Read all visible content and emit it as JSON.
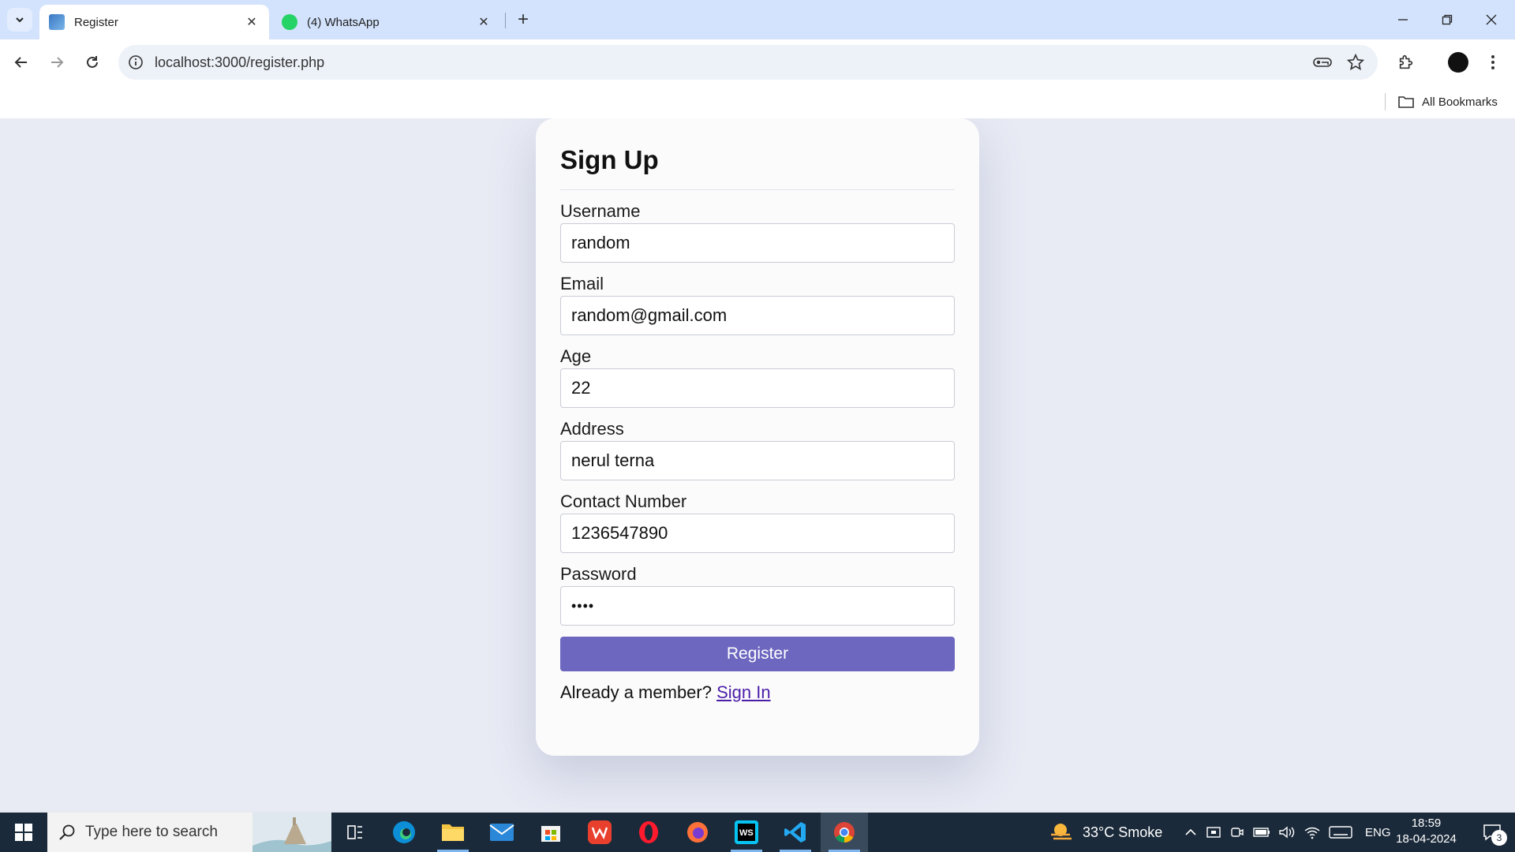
{
  "browser": {
    "tabs": [
      {
        "title": "Register",
        "active": true
      },
      {
        "title": "(4) WhatsApp",
        "active": false
      }
    ],
    "url": "localhost:3000/register.php",
    "bookmarks_label": "All Bookmarks"
  },
  "form": {
    "title": "Sign Up",
    "fields": [
      {
        "label": "Username",
        "value": "random"
      },
      {
        "label": "Email",
        "value": "random@gmail.com"
      },
      {
        "label": "Age",
        "value": "22"
      },
      {
        "label": "Address",
        "value": "nerul terna"
      },
      {
        "label": "Contact Number",
        "value": "1236547890"
      },
      {
        "label": "Password",
        "value": "••••"
      }
    ],
    "submit_label": "Register",
    "member_text": "Already a member?",
    "signin_link": "Sign In"
  },
  "taskbar": {
    "search_placeholder": "Type here to search",
    "weather": "33°C  Smoke",
    "language": "ENG",
    "time": "18:59",
    "date": "18-04-2024",
    "notification_count": "3"
  },
  "colors": {
    "accent": "#6d67c0",
    "tabbar": "#d3e3fd",
    "taskbar": "#1b2a3a"
  }
}
